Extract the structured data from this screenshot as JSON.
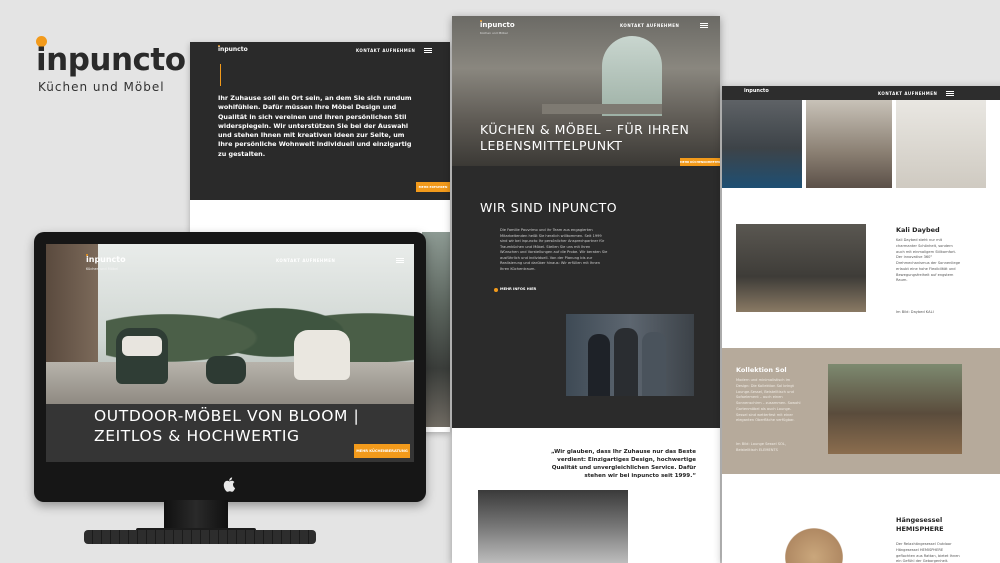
{
  "brand": {
    "name": "inpuncto",
    "tagline": "Küchen und Möbel",
    "accent_color": "#f29a1b"
  },
  "page_a": {
    "nav_contact": "KONTAKT AUFNEHMEN",
    "intro_text": "Ihr Zuhause soll ein Ort sein, an dem Sie sich rundum wohlfühlen. Dafür müssen Ihre Möbel Design und Qualität in sich vereinen und Ihren persönlichen Stil widerspiegeln. Wir unterstützen Sie bei der Auswahl und stehen Ihnen mit kreativen Ideen zur Seite, um Ihre persönliche Wohnwelt individuell und einzigartig zu gestalten.",
    "button_label": "MEHR ERFAHREN"
  },
  "page_b": {
    "nav_contact": "KONTAKT AUFNEHMEN",
    "hero_title": "KÜCHEN & MÖBEL – FÜR IHREN LEBENSMITTELPUNKT",
    "hero_button": "MEHR KÜCHENKOMPETENZ",
    "section_title": "WIR SIND INPUNCTO",
    "section_body": "Die Familie Pauvrimo und ihr Team aus engagierten Mitarbeitenden heißt Sie herzlich willkommen. Seit 1999 sind wir bei inpuncto Ihr persönlicher Ansprechpartner für Traumküchen und Möbel. Stellen Sie uns mit Ihren Wünschen und Vorstellungen auf die Probe. Wir beraten Sie ausführlich und individuell. Von der Planung bis zur Realisierung und darüber hinaus: Wir erfüllen mit Ihnen Ihren Küchentraum.",
    "more_link": "MEHR INFOS HIER",
    "quote": "„Wir glauben, dass Ihr Zuhause nur das Beste verdient: Einzigartiges Design, hochwertige Qualität und unvergleichlichen Service. Dafür stehen wir bei inpuncto seit 1999.“"
  },
  "page_c": {
    "nav_contact": "KONTAKT AUFNEHMEN",
    "kali_title": "Kali Daybed",
    "kali_body": "Kali Daybed steht nur mit charmanter Schönheit, sondern auch mit einmaligem Stilkomfort. Der innovative 360° Drehmechanismus der Sonnenliege erlaubt eine hohe Flexibilität und Bewegungsfreiheit auf engstem Raum.",
    "kali_caption": "Im Bild: Daybed KALI",
    "sol_title": "Kollektion Sol",
    "sol_body": "Modern und minimalistisch im Design: Die Kollektion Sol bringt Lounge-Sessel, Beistelltisch und Sofaelement – auch einen Sonnenschirm – zusammen. Sowohl Gartenmöbel als auch Lounge-Sessel sind wetterfest mit einer eleganten Oberfläche verfügbar.",
    "sol_caption": "Im Bild: Lounge Sessel SOL, Beistelltisch ELEMENTS",
    "haenge_title": "Hängesessel HEMISPHERE",
    "haenge_body": "Der Relaxhängesessel Outdoor Hängesessel HEMISPHERE geflochten aus Rattan, bietet Ihnen ein Gefühl der Geborgenheit."
  },
  "imac_page": {
    "nav_contact": "KONTAKT AUFNEHMEN",
    "hero_title": "OUTDOOR-MÖBEL VON BLOOM | ZEITLOS & HOCHWERTIG",
    "hero_button": "MEHR KÜCHENBERATUNG"
  },
  "icons": {
    "menu": "hamburger-icon",
    "device": "apple-icon"
  }
}
